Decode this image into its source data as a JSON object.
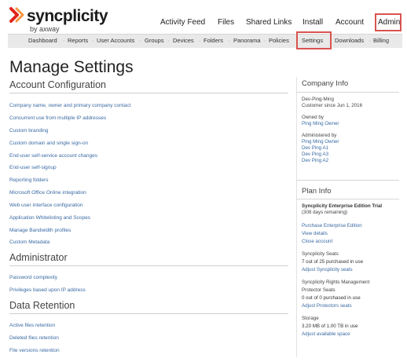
{
  "brand": {
    "name": "syncplicity",
    "sub": "by axway",
    "accent": "#3a6aa3",
    "highlight": "#d9534f"
  },
  "topnav": [
    "Activity Feed",
    "Files",
    "Shared Links",
    "Install",
    "Account",
    "Admin"
  ],
  "subnav": [
    "Dashboard",
    "Reports",
    "User Accounts",
    "Groups",
    "Devices",
    "Folders",
    "Panorama",
    "Policies",
    "Settings",
    "Downloads",
    "Billing"
  ],
  "page_title": "Manage Settings",
  "account_configuration": {
    "title": "Account Configuration",
    "links": [
      "Company name, owner and primary company contact",
      "Concurrent use from multiple IP addresses",
      "Custom branding",
      "Custom domain and single sign-on",
      "End-user self-service account changes",
      "End-user self-signup",
      "Reporting folders",
      "Microsoft Office Online integration",
      "Web user interface configuration",
      "Application Whitelisting and Scopes",
      "Manage Bandwidth profiles",
      "Custom Metadata"
    ]
  },
  "administrator": {
    "title": "Administrator",
    "links": [
      "Password complexity",
      "Privileges based upon IP address"
    ]
  },
  "data_retention": {
    "title": "Data Retention",
    "links": [
      "Active files retention",
      "Deleted files retention",
      "File versions retention"
    ]
  },
  "company_info": {
    "title": "Company Info",
    "company_name": "Dev-Ping-Ming",
    "customer_since": "Customer since Jun 1, 2016",
    "owned_by_label": "Owned by",
    "owner": "Ping Ming Owner",
    "administered_by_label": "Administered by",
    "administrators": [
      "Ping Ming Owner",
      "Dev Ping A1",
      "Dev Ping A3",
      "Dev Ping A2"
    ]
  },
  "plan_info": {
    "title": "Plan Info",
    "edition": "Syncplicity Enterprise Edition Trial",
    "days_remaining": "(308 days remaining)",
    "actions": [
      "Purchase Enterprise Edition",
      "View details",
      "Close account"
    ],
    "seats_label": "Syncplicity Seats",
    "seats_value": "7 out of 25 purchased in use",
    "seats_action": "Adjust Syncplicity seats",
    "rights_label_1": "Syncplicity Rights Management",
    "rights_label_2": "Protector Seats",
    "rights_value": "0 out of 0 purchased in use",
    "rights_action": "Adjust Protectors seats",
    "storage_label": "Storage",
    "storage_value": "3.20 MB of 1.00 TB in use",
    "storage_action": "Adjust available space"
  }
}
